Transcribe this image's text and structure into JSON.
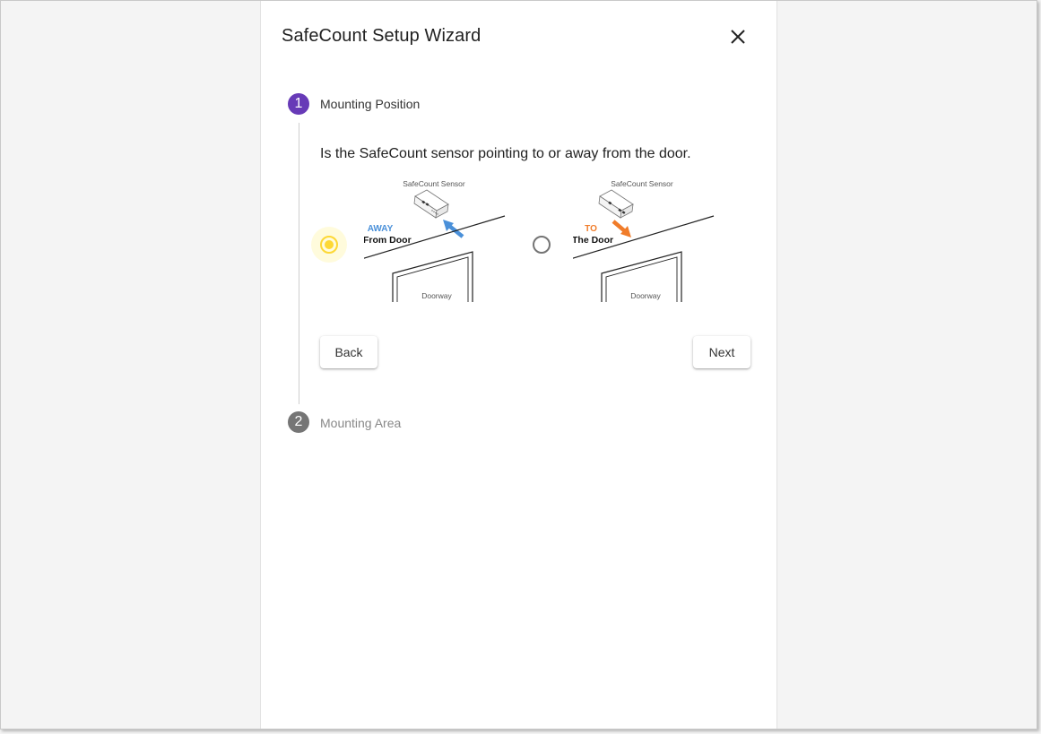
{
  "wizard": {
    "title": "SafeCount Setup Wizard",
    "close_icon": "close-icon"
  },
  "steps": [
    {
      "number": "1",
      "label": "Mounting Position",
      "state": "active",
      "color": "#673ab7"
    },
    {
      "number": "2",
      "label": "Mounting Area",
      "state": "inactive",
      "color": "#757575"
    }
  ],
  "step1": {
    "question": "Is the SafeCount sensor pointing to or away from the door.",
    "options": [
      {
        "id": "away",
        "selected": true,
        "sensor_label": "SafeCount Sensor",
        "direction_word": "AWAY",
        "direction_rest": "From Door",
        "door_label": "Doorway",
        "accent_color": "#4a90d9"
      },
      {
        "id": "to",
        "selected": false,
        "sensor_label": "SafeCount Sensor",
        "direction_word": "TO",
        "direction_rest": "The Door",
        "door_label": "Doorway",
        "accent_color": "#f07c2a"
      }
    ],
    "back_label": "Back",
    "next_label": "Next"
  },
  "colors": {
    "selected_radio": "#fdd835",
    "step_active": "#673ab7",
    "step_inactive": "#757575"
  }
}
